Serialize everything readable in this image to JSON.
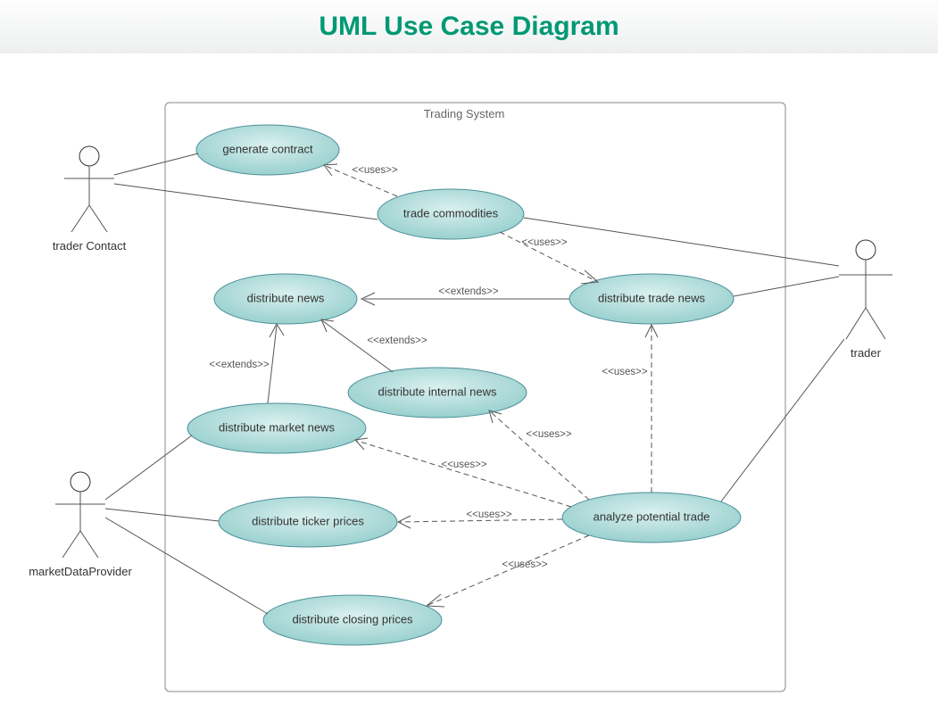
{
  "title": "UML Use Case Diagram",
  "system": {
    "label": "Trading System"
  },
  "actors": {
    "traderContact": {
      "label": "trader Contact"
    },
    "marketDataProvider": {
      "label": "marketDataProvider"
    },
    "trader": {
      "label": "trader"
    }
  },
  "usecases": {
    "generateContract": "generate contract",
    "tradeCommodities": "trade commodities",
    "distributeTradeNews": "distribute trade news",
    "distributeNews": "distribute news",
    "distributeInternalNews": "distribute internal news",
    "distributeMarketNews": "distribute market news",
    "distributeTickerPrices": "distribute ticker prices",
    "distributeClosingPrices": "distribute closing prices",
    "analyzePotentialTrade": "analyze potential trade"
  },
  "stereotypes": {
    "uses": "<<uses>>",
    "extends": "<<extends>>"
  }
}
